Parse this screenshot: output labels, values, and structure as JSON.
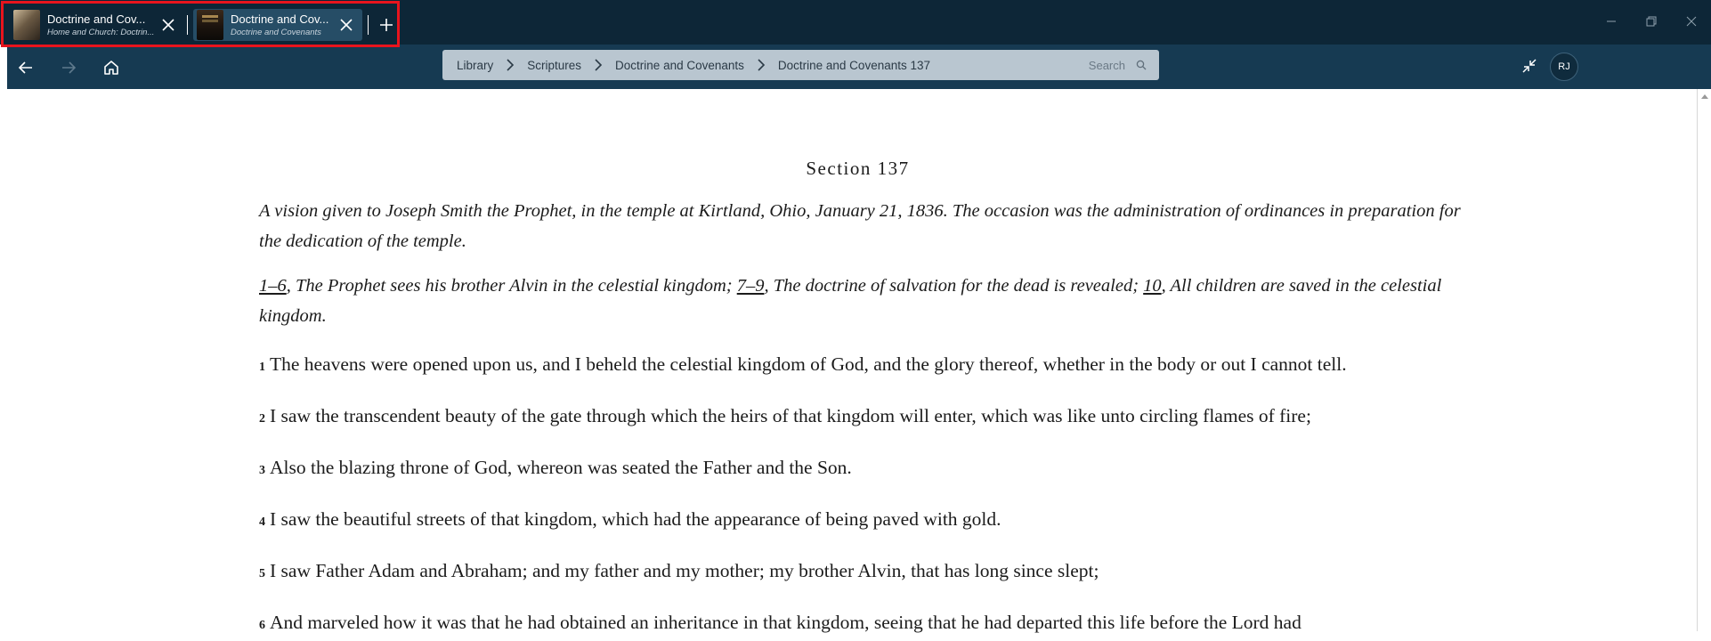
{
  "tabs": [
    {
      "title": "Doctrine and Cov...",
      "subtitle": "Home and Church: Doctrin..."
    },
    {
      "title": "Doctrine and Cov...",
      "subtitle": "Doctrine and Covenants"
    }
  ],
  "breadcrumb": {
    "items": [
      "Library",
      "Scriptures",
      "Doctrine and Covenants",
      "Doctrine and Covenants 137"
    ],
    "search_placeholder": "Search"
  },
  "user": {
    "initials": "RJ"
  },
  "content": {
    "section_title": "Section 137",
    "intro": "A vision given to Joseph Smith the Prophet, in the temple at Kirtland, Ohio, January 21, 1836. The occasion was the administration of ordinances in preparation for the dedication of the temple.",
    "summary": [
      {
        "ref": "1–6",
        "text": ", The Prophet sees his brother Alvin in the celestial kingdom; "
      },
      {
        "ref": "7–9",
        "text": ", The doctrine of salvation for the dead is revealed; "
      },
      {
        "ref": "10",
        "text": ", All children are saved in the celestial kingdom."
      }
    ],
    "verses": [
      {
        "num": "1",
        "text": "The heavens were opened upon us, and I beheld the celestial kingdom of God, and the glory thereof, whether in the body or out I cannot tell."
      },
      {
        "num": "2",
        "text": "I saw the transcendent beauty of the gate through which the heirs of that kingdom will enter, which was like unto circling flames of fire;"
      },
      {
        "num": "3",
        "text": "Also the blazing throne of God, whereon was seated the Father and the Son."
      },
      {
        "num": "4",
        "text": "I saw the beautiful streets of that kingdom, which had the appearance of being paved with gold."
      },
      {
        "num": "5",
        "text": "I saw Father Adam and Abraham; and my father and my mother; my brother Alvin, that has long since slept;"
      },
      {
        "num": "6",
        "text": "And marveled how it was that he had obtained an inheritance in that kingdom, seeing that he had departed this life before the Lord had"
      }
    ]
  },
  "colors": {
    "titlebar": "#0d2637",
    "navbar": "#163a52",
    "breadcrumb_bg": "#b9c6d0",
    "highlight": "#e8141d"
  }
}
